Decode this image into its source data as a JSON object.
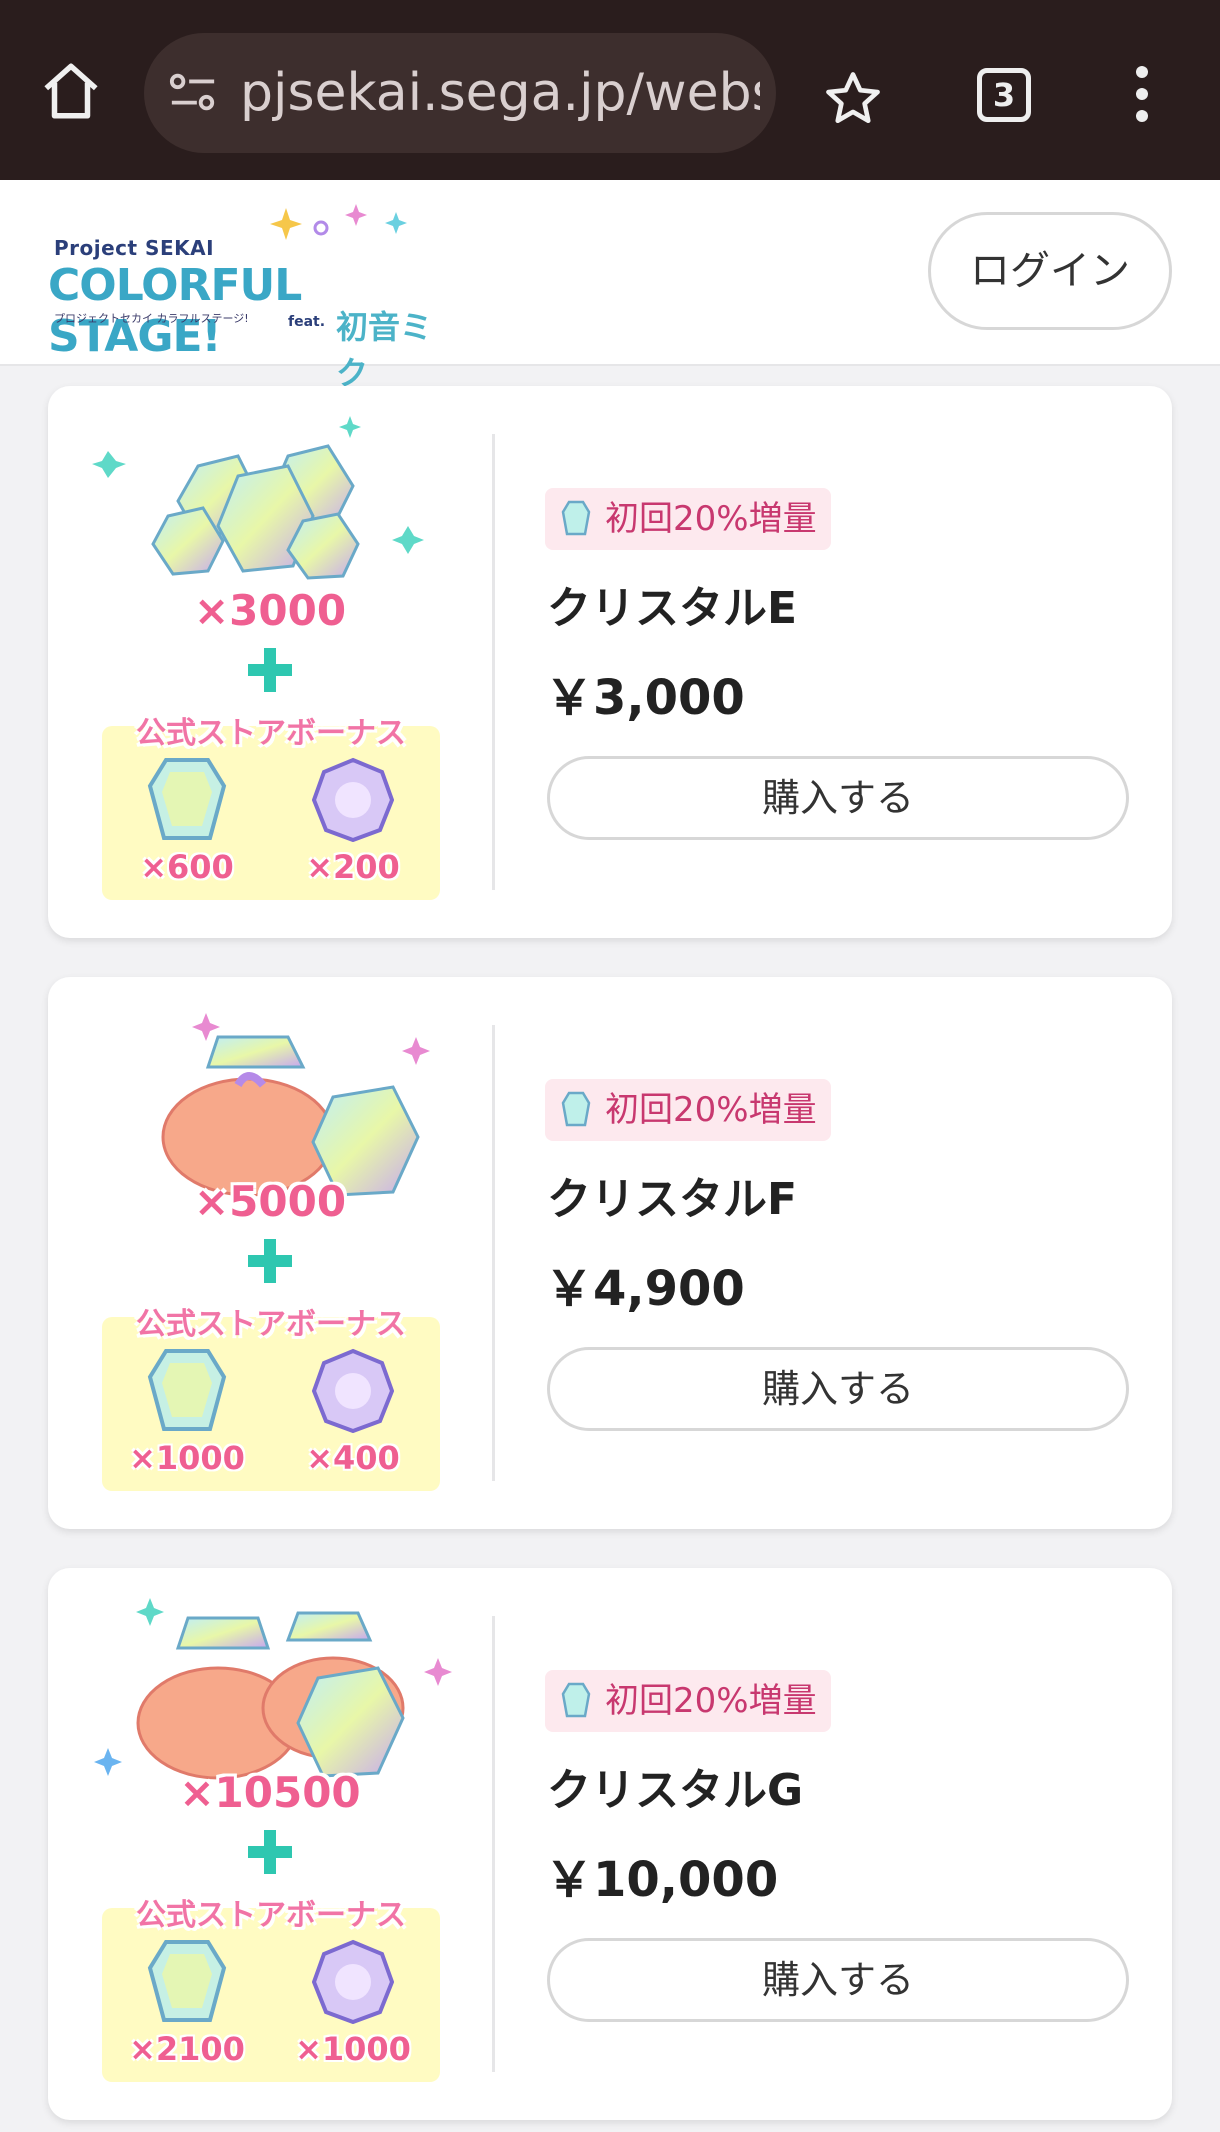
{
  "browser": {
    "url": "pjsekai.sega.jp/webst",
    "tab_count": "3"
  },
  "header": {
    "logo_small": "Project SEKAI",
    "logo_main": "COLORFUL STAGE!",
    "logo_sub": "プロジェクトセカイ カラフルステージ!",
    "logo_feat": "feat.",
    "logo_miku": "初音ミク",
    "login_label": "ログイン"
  },
  "products": [
    {
      "qty": "×3000",
      "bonus_title": "公式ストアボーナス",
      "bonus_crystal": "×600",
      "bonus_gem": "×200",
      "badge": "初回20%増量",
      "name": "クリスタルE",
      "price": "￥3,000",
      "buy_label": "購入する"
    },
    {
      "qty": "×5000",
      "bonus_title": "公式ストアボーナス",
      "bonus_crystal": "×1000",
      "bonus_gem": "×400",
      "badge": "初回20%増量",
      "name": "クリスタルF",
      "price": "￥4,900",
      "buy_label": "購入する"
    },
    {
      "qty": "×10500",
      "bonus_title": "公式ストアボーナス",
      "bonus_crystal": "×2100",
      "bonus_gem": "×1000",
      "badge": "初回20%増量",
      "name": "クリスタルG",
      "price": "￥10,000",
      "buy_label": "購入する"
    }
  ],
  "colors": {
    "accent_pink": "#ef5f91",
    "plus_teal": "#2ec7b0",
    "bonus_bg": "#fffbc2",
    "badge_bg": "#fde9ee"
  }
}
